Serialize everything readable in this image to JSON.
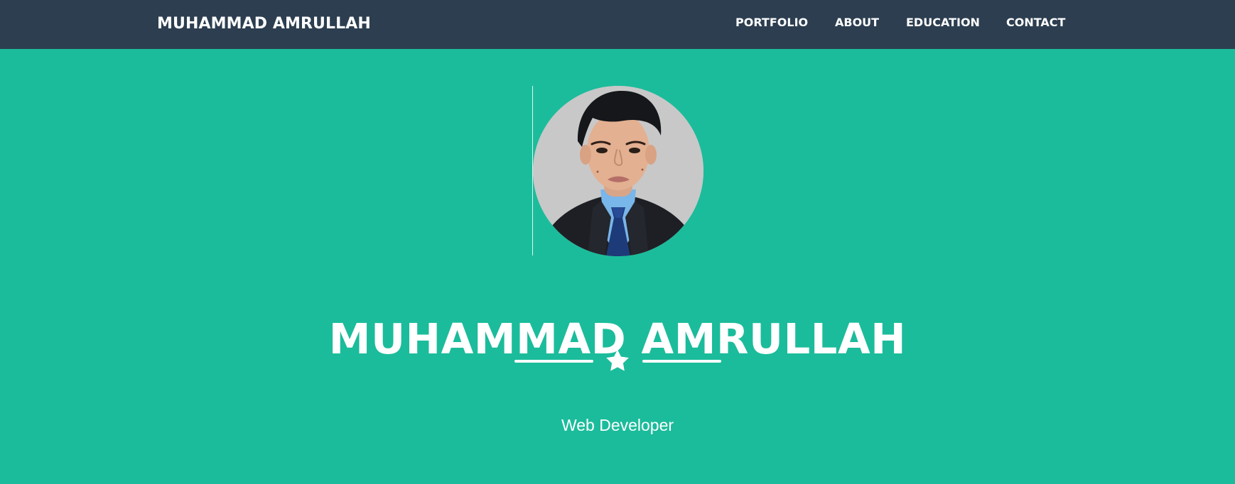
{
  "navbar": {
    "brand": "MUHAMMAD AMRULLAH",
    "links": [
      {
        "label": "PORTFOLIO"
      },
      {
        "label": "ABOUT"
      },
      {
        "label": "EDUCATION"
      },
      {
        "label": "CONTACT"
      }
    ]
  },
  "hero": {
    "avatar_icon": "profile-photo",
    "title": "MUHAMMAD AMRULLAH",
    "divider_icon": "star-icon",
    "subtitle": "Web Developer"
  },
  "colors": {
    "navbar_bg": "#2c3e50",
    "hero_bg": "#1bbc9b",
    "text": "#ffffff",
    "avatar_bg": "#c7c7c7"
  }
}
